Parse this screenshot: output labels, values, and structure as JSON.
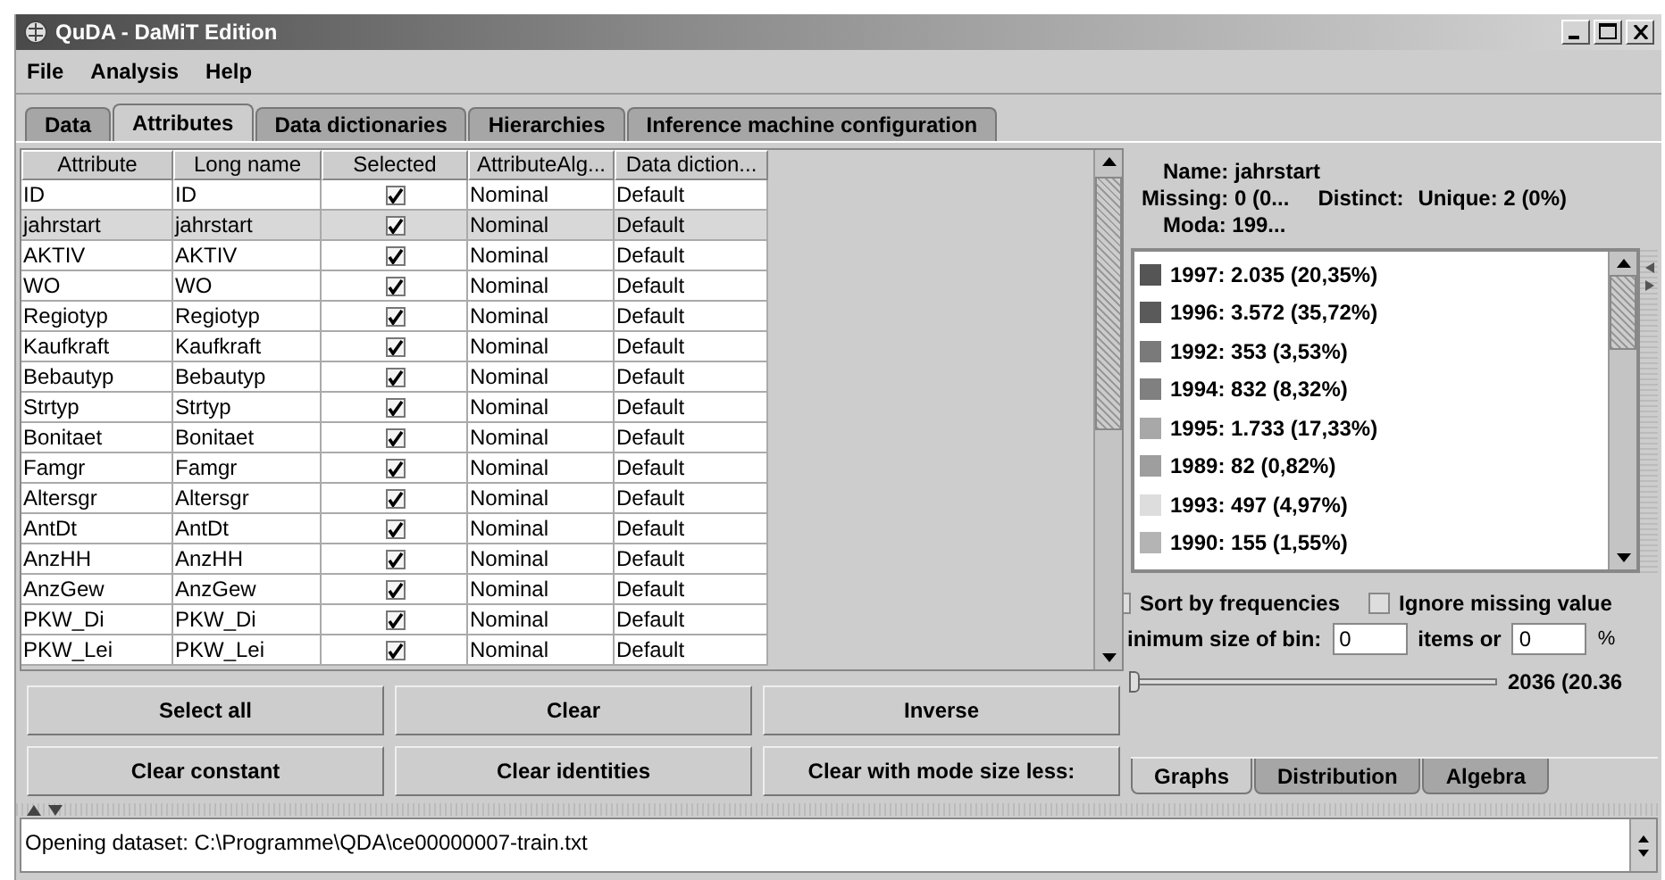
{
  "window": {
    "title": "QuDA - DaMiT Edition"
  },
  "menu": [
    "File",
    "Analysis",
    "Help"
  ],
  "tabs": [
    {
      "label": "Data",
      "selected": false
    },
    {
      "label": "Attributes",
      "selected": true
    },
    {
      "label": "Data dictionaries",
      "selected": false
    },
    {
      "label": "Hierarchies",
      "selected": false
    },
    {
      "label": "Inference machine configuration",
      "selected": false
    }
  ],
  "table": {
    "columns": [
      "Attribute",
      "Long name",
      "Selected",
      "AttributeAlg...",
      "Data diction..."
    ],
    "rows": [
      {
        "attribute": "ID",
        "long_name": "ID",
        "checked": true,
        "algebra": "Nominal",
        "dictionary": "Default",
        "selected": false
      },
      {
        "attribute": "jahrstart",
        "long_name": "jahrstart",
        "checked": true,
        "algebra": "Nominal",
        "dictionary": "Default",
        "selected": true
      },
      {
        "attribute": "AKTIV",
        "long_name": "AKTIV",
        "checked": true,
        "algebra": "Nominal",
        "dictionary": "Default",
        "selected": false
      },
      {
        "attribute": "WO",
        "long_name": "WO",
        "checked": true,
        "algebra": "Nominal",
        "dictionary": "Default",
        "selected": false
      },
      {
        "attribute": "Regiotyp",
        "long_name": "Regiotyp",
        "checked": true,
        "algebra": "Nominal",
        "dictionary": "Default",
        "selected": false
      },
      {
        "attribute": "Kaufkraft",
        "long_name": "Kaufkraft",
        "checked": true,
        "algebra": "Nominal",
        "dictionary": "Default",
        "selected": false
      },
      {
        "attribute": "Bebautyp",
        "long_name": "Bebautyp",
        "checked": true,
        "algebra": "Nominal",
        "dictionary": "Default",
        "selected": false
      },
      {
        "attribute": "Strtyp",
        "long_name": "Strtyp",
        "checked": true,
        "algebra": "Nominal",
        "dictionary": "Default",
        "selected": false
      },
      {
        "attribute": "Bonitaet",
        "long_name": "Bonitaet",
        "checked": true,
        "algebra": "Nominal",
        "dictionary": "Default",
        "selected": false
      },
      {
        "attribute": "Famgr",
        "long_name": "Famgr",
        "checked": true,
        "algebra": "Nominal",
        "dictionary": "Default",
        "selected": false
      },
      {
        "attribute": "Altersgr",
        "long_name": "Altersgr",
        "checked": true,
        "algebra": "Nominal",
        "dictionary": "Default",
        "selected": false
      },
      {
        "attribute": "AntDt",
        "long_name": "AntDt",
        "checked": true,
        "algebra": "Nominal",
        "dictionary": "Default",
        "selected": false
      },
      {
        "attribute": "AnzHH",
        "long_name": "AnzHH",
        "checked": true,
        "algebra": "Nominal",
        "dictionary": "Default",
        "selected": false
      },
      {
        "attribute": "AnzGew",
        "long_name": "AnzGew",
        "checked": true,
        "algebra": "Nominal",
        "dictionary": "Default",
        "selected": false
      },
      {
        "attribute": "PKW_Di",
        "long_name": "PKW_Di",
        "checked": true,
        "algebra": "Nominal",
        "dictionary": "Default",
        "selected": false
      },
      {
        "attribute": "PKW_Lei",
        "long_name": "PKW_Lei",
        "checked": true,
        "algebra": "Nominal",
        "dictionary": "Default",
        "selected": false
      }
    ]
  },
  "buttons": [
    "Select all",
    "Clear",
    "Inverse",
    "Clear constant",
    "Clear identities",
    "Clear with mode size less:"
  ],
  "info": {
    "name": "Name: jahrstart",
    "missing": "Missing: 0 (0...",
    "distinct": "Distinct:",
    "unique": "Unique: 2 (0%)",
    "moda": "Moda: 199..."
  },
  "legend": [
    {
      "label": "1997: 2.035 (20,35%)",
      "color": "#555555"
    },
    {
      "label": "1996: 3.572 (35,72%)",
      "color": "#5a5a5a"
    },
    {
      "label": "1992: 353 (3,53%)",
      "color": "#7a7a7a"
    },
    {
      "label": "1994: 832 (8,32%)",
      "color": "#808080"
    },
    {
      "label": "1995: 1.733 (17,33%)",
      "color": "#a8a8a8"
    },
    {
      "label": "1989: 82 (0,82%)",
      "color": "#9e9e9e"
    },
    {
      "label": "1993: 497 (4,97%)",
      "color": "#dddddd"
    },
    {
      "label": "1990: 155 (1,55%)",
      "color": "#b4b4b4"
    }
  ],
  "options": [
    {
      "label": "Sort by frequencies",
      "checked": false
    },
    {
      "label": "Ignore missing value",
      "checked": false
    }
  ],
  "bin": {
    "label": "inimum size of bin:",
    "value": "0",
    "middle": "items or",
    "percent_value": "0",
    "unit": "%"
  },
  "slider": {
    "level": 0,
    "reading": "2036 (20.36"
  },
  "bottom_tabs": [
    {
      "label": "Graphs",
      "selected": true
    },
    {
      "label": "Distribution",
      "selected": false
    },
    {
      "label": "Algebra",
      "selected": false
    }
  ],
  "status_log": "Opening dataset: C:\\Programme\\QDA\\ce00000007-train.txt"
}
